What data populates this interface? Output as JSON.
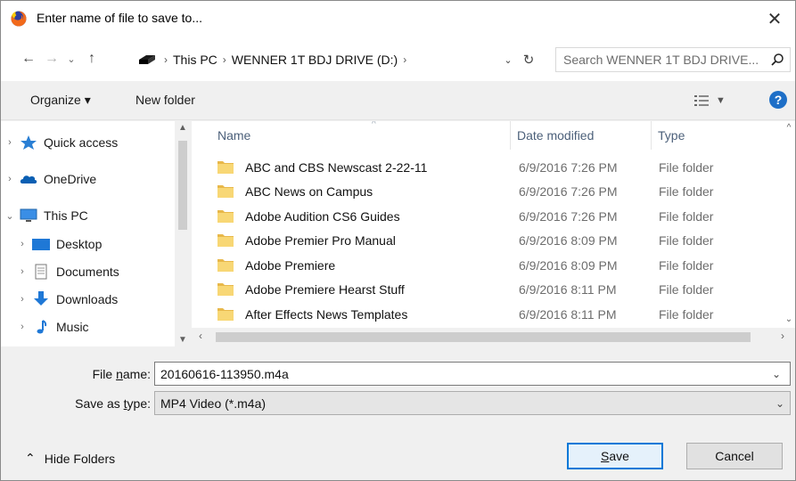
{
  "window": {
    "title": "Enter name of file to save to...",
    "close_glyph": "✕"
  },
  "address": {
    "crumbs": [
      "This PC",
      "WENNER 1T BDJ DRIVE (D:)"
    ],
    "search_placeholder": "Search WENNER 1T BDJ DRIVE...",
    "nav_back": "←",
    "nav_forward": "→",
    "nav_recent": "⌄",
    "nav_up": "↑",
    "dropdown_glyph": "⌄",
    "refresh_glyph": "↻"
  },
  "toolbar": {
    "organize_label": "Organize ▾",
    "new_folder_label": "New folder",
    "help_label": "?"
  },
  "sidebar": {
    "items": [
      {
        "label": "Quick access",
        "chevron": "›",
        "icon": "star-icon"
      },
      {
        "label": "OneDrive",
        "chevron": "›",
        "icon": "cloud-icon"
      },
      {
        "label": "This PC",
        "chevron": "⌄",
        "icon": "computer-icon"
      },
      {
        "label": "Desktop",
        "chevron": "›",
        "icon": "desktop-icon"
      },
      {
        "label": "Documents",
        "chevron": "›",
        "icon": "documents-icon"
      },
      {
        "label": "Downloads",
        "chevron": "›",
        "icon": "downloads-icon"
      },
      {
        "label": "Music",
        "chevron": "›",
        "icon": "music-icon"
      }
    ]
  },
  "filelist": {
    "columns": {
      "name": "Name",
      "date": "Date modified",
      "type": "Type"
    },
    "rows": [
      {
        "name": "ABC and CBS Newscast 2-22-11",
        "date": "6/9/2016 7:26 PM",
        "type": "File folder"
      },
      {
        "name": "ABC News on Campus",
        "date": "6/9/2016 7:26 PM",
        "type": "File folder"
      },
      {
        "name": "Adobe Audition CS6 Guides",
        "date": "6/9/2016 7:26 PM",
        "type": "File folder"
      },
      {
        "name": "Adobe Premier Pro Manual",
        "date": "6/9/2016 8:09 PM",
        "type": "File folder"
      },
      {
        "name": "Adobe Premiere",
        "date": "6/9/2016 8:09 PM",
        "type": "File folder"
      },
      {
        "name": "Adobe Premiere Hearst Stuff",
        "date": "6/9/2016 8:11 PM",
        "type": "File folder"
      },
      {
        "name": "After Effects News Templates",
        "date": "6/9/2016 8:11 PM",
        "type": "File folder"
      }
    ]
  },
  "form": {
    "file_name_label_pre": "File ",
    "file_name_label_key": "n",
    "file_name_label_post": "ame:",
    "file_name_value": "20160616-113950.m4a",
    "save_type_label_pre": "Save as ",
    "save_type_label_key": "t",
    "save_type_label_post": "ype:",
    "save_type_value": "MP4 Video (*.m4a)"
  },
  "footer": {
    "hide_folders_label": "Hide Folders",
    "save_key": "S",
    "save_rest": "ave",
    "cancel_label": "Cancel"
  },
  "colors": {
    "accent": "#0078d7",
    "folder": "#f8d775",
    "help": "#1e6fc7"
  }
}
